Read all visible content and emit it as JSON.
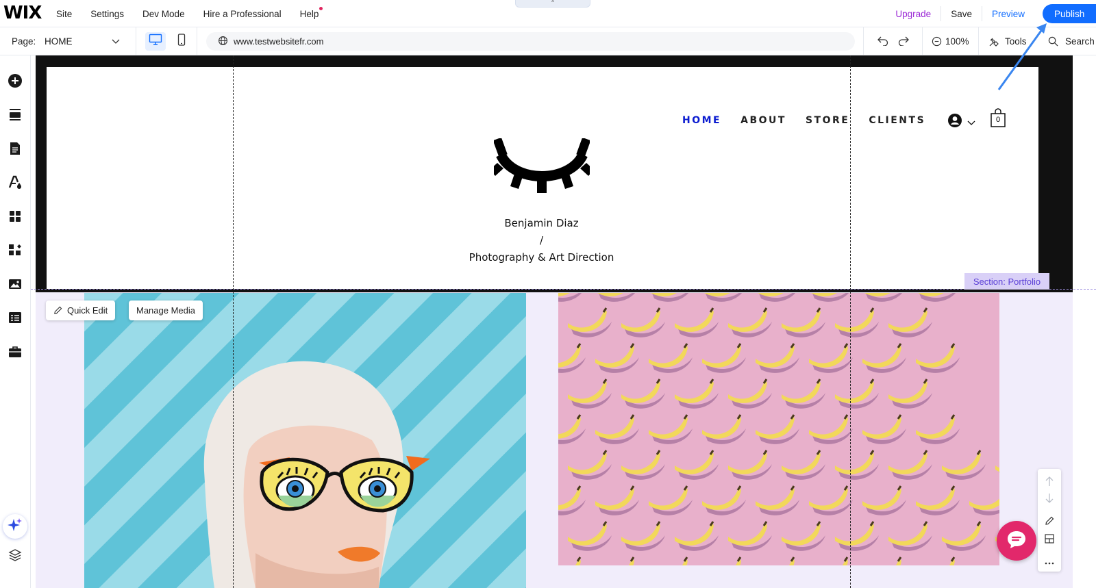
{
  "topbar": {
    "logo": "WIX",
    "menu": [
      "Site",
      "Settings",
      "Dev Mode",
      "Hire a Professional",
      "Help"
    ],
    "collapse_glyph": "⌃",
    "upgrade": "Upgrade",
    "save": "Save",
    "preview": "Preview",
    "publish": "Publish"
  },
  "bar2": {
    "page_label": "Page:",
    "page_value": "HOME",
    "url": "www.testwebsitefr.com",
    "zoom": "100%",
    "tools": "Tools",
    "search": "Search"
  },
  "site": {
    "nav": [
      "HOME",
      "ABOUT",
      "STORE",
      "CLIENTS"
    ],
    "cart_count": "0",
    "name_line1": "Benjamin Diaz",
    "name_line2": "/",
    "name_line3": "Photography & Art Direction"
  },
  "editor": {
    "section_tag": "Section: Portfolio",
    "quick_edit": "Quick Edit",
    "manage_media": "Manage Media"
  },
  "colors": {
    "accent": "#116dff",
    "upgrade": "#9a27d5",
    "nav_active": "#0b1bd0",
    "section": "#5a3fd6",
    "chat": "#e2286b",
    "photo_left_bg": "#5fc3d8",
    "photo_right_bg": "#e8b0cb"
  }
}
